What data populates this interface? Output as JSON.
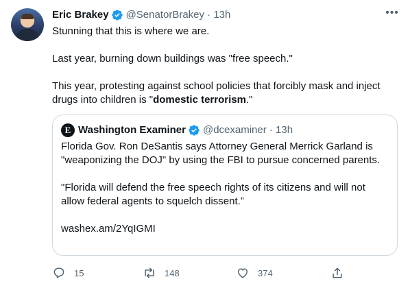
{
  "tweet": {
    "author_name": "Eric Brakey",
    "handle_time": "@SenatorBrakey · 13h",
    "more_icon": "more-icon",
    "text": {
      "line1": "Stunning that this is where we are.",
      "line2": "Last year, burning down buildings was \"free speech.\"",
      "line3_prefix": "This year, protesting against school policies that forcibly mask and inject drugs into children is \"",
      "line3_bold": "domestic terrorism",
      "line3_suffix": ".\""
    }
  },
  "quote": {
    "author_name": "Washington Examiner",
    "handle_time": "@dcexaminer · 13h",
    "para1": "Florida Gov. Ron DeSantis says Attorney General Merrick Garland is \"weaponizing the DOJ\" by using the FBI to pursue concerned parents.",
    "para2": "\"Florida will defend the free speech rights of its citizens and will not allow federal agents to squelch dissent.”",
    "link": "washex.am/2YqIGMI"
  },
  "actions": {
    "replies": "15",
    "retweets": "148",
    "likes": "374"
  },
  "colors": {
    "text": "#0f1419",
    "secondary": "#536471",
    "verified": "#1d9bf0",
    "border": "#cfd9de"
  }
}
